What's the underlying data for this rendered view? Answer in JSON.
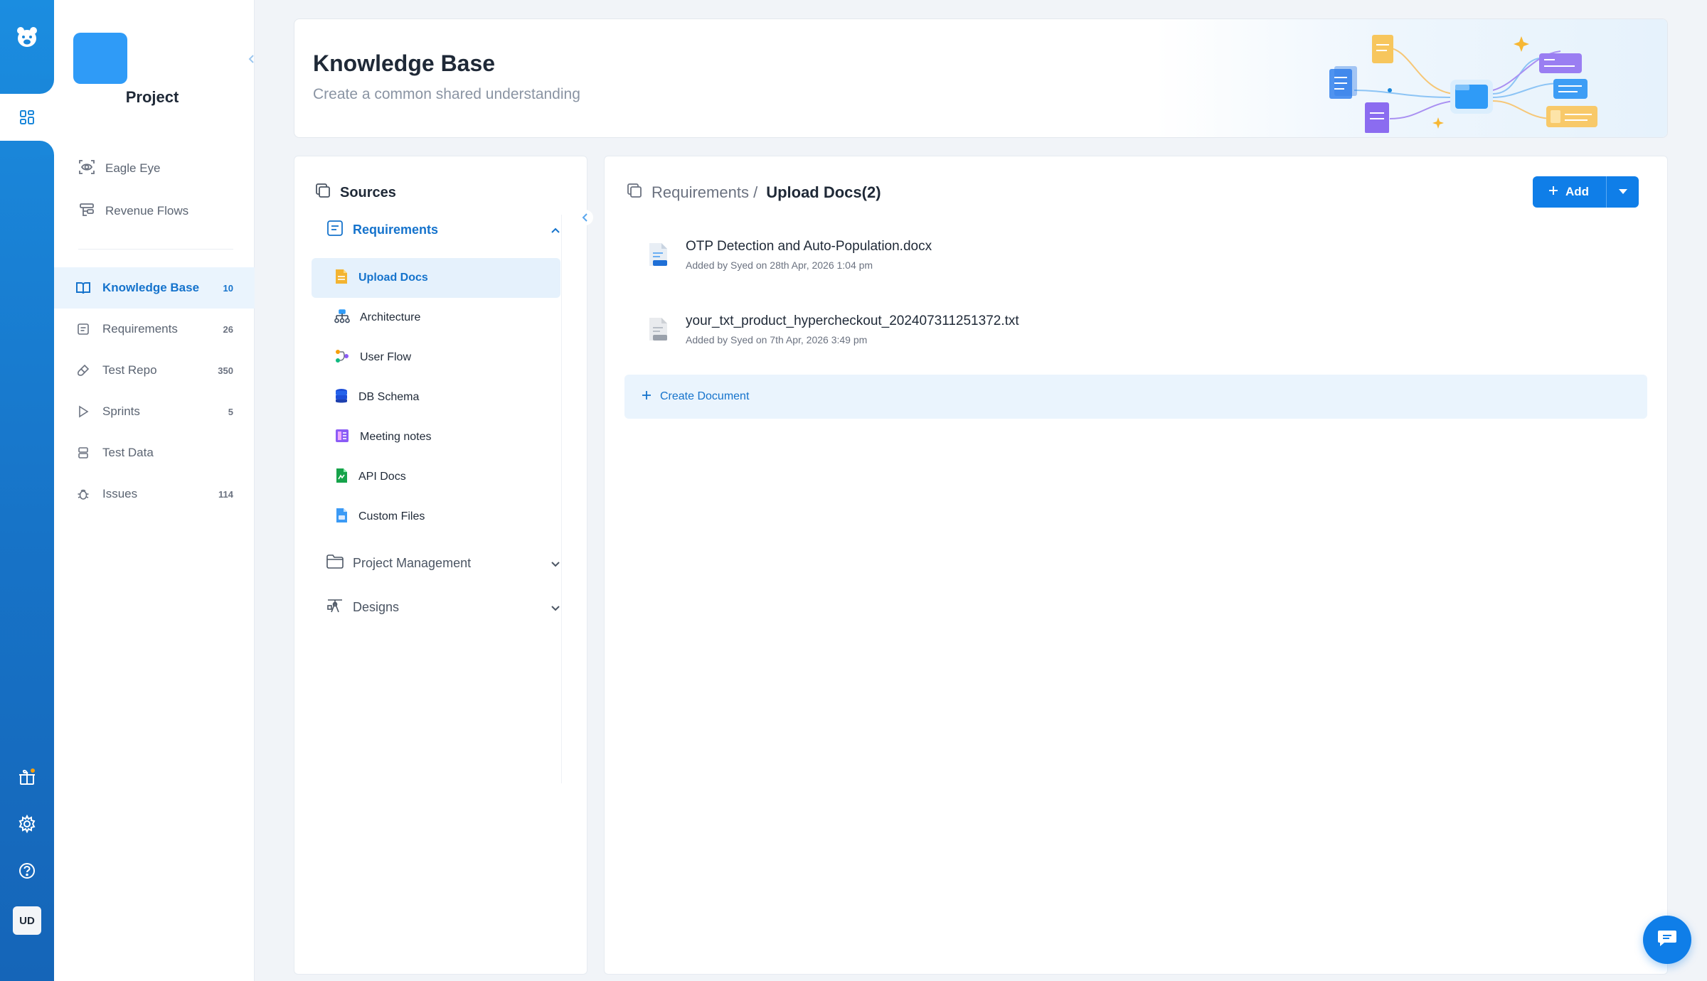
{
  "rail": {
    "logo_icon": "bear-logo-icon",
    "active_icon": "dashboard-grid-icon",
    "bottom_icons": [
      "gift-icon",
      "gear-icon",
      "help-icon"
    ],
    "avatar_initials": "UD"
  },
  "project": {
    "name": "Project",
    "top_items": [
      {
        "label": "Eagle Eye",
        "icon": "eye-scan-icon"
      },
      {
        "label": "Revenue Flows",
        "icon": "flows-icon"
      }
    ],
    "nav": [
      {
        "label": "Knowledge Base",
        "count": "10",
        "icon": "book-icon",
        "active": true
      },
      {
        "label": "Requirements",
        "count": "26",
        "icon": "list-icon"
      },
      {
        "label": "Test Repo",
        "count": "350",
        "icon": "flask-icon"
      },
      {
        "label": "Sprints",
        "count": "5",
        "icon": "play-icon"
      },
      {
        "label": "Test Data",
        "count": "",
        "icon": "database-icon"
      },
      {
        "label": "Issues",
        "count": "114",
        "icon": "bug-icon"
      }
    ]
  },
  "header": {
    "title": "Knowledge Base",
    "subtitle": "Create a common shared understanding"
  },
  "sources": {
    "title": "Sources",
    "groups": [
      {
        "label": "Requirements",
        "open": true
      },
      {
        "label": "Project Management",
        "open": false
      },
      {
        "label": "Designs",
        "open": false
      }
    ],
    "sub_items": [
      {
        "label": "Upload Docs",
        "icon": "upload-doc-icon",
        "active": true
      },
      {
        "label": "Architecture",
        "icon": "architecture-icon"
      },
      {
        "label": "User Flow",
        "icon": "user-flow-icon"
      },
      {
        "label": "DB Schema",
        "icon": "db-schema-icon"
      },
      {
        "label": "Meeting notes",
        "icon": "meeting-notes-icon"
      },
      {
        "label": "API Docs",
        "icon": "api-docs-icon"
      },
      {
        "label": "Custom Files",
        "icon": "custom-files-icon"
      }
    ]
  },
  "content": {
    "breadcrumb_parent": "Requirements /",
    "breadcrumb_current": "Upload Docs(2)",
    "add_label": "Add",
    "documents": [
      {
        "name": "OTP Detection and Auto-Population.docx",
        "meta": "Added by Syed on 28th Apr, 2026 1:04 pm",
        "type": "DOC"
      },
      {
        "name": "your_txt_product_hypercheckout_202407311251372.txt",
        "meta": "Added by Syed on 7th Apr, 2026 3:49 pm",
        "type": "TXT"
      }
    ],
    "create_label": "Create Document"
  },
  "colors": {
    "brand": "#0f7ee8",
    "active_bg": "#eaf4fd",
    "active_text": "#1573cc"
  }
}
